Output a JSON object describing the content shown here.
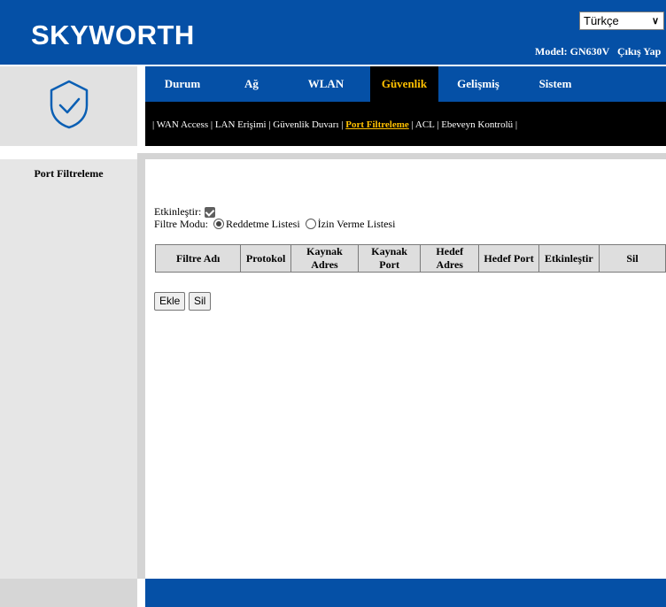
{
  "header": {
    "logo": "SKYWORTH",
    "language": "Türkçe",
    "model": "Model: GN630V",
    "logout": "Çıkış Yap"
  },
  "topnav": {
    "tabs": [
      "Durum",
      "Ağ",
      "WLAN",
      "Güvenlik",
      "Gelişmiş",
      "Sistem"
    ],
    "active": "Güvenlik"
  },
  "subnav": {
    "items": [
      "WAN Access",
      "LAN Erişimi",
      "Güvenlik Duvarı",
      "Port Filtreleme",
      "ACL",
      "Ebeveyn Kontrolü"
    ],
    "active": "Port Filtreleme"
  },
  "sidebar": {
    "item": "Port Filtreleme",
    "icon": "shield-check-icon"
  },
  "form": {
    "enable_label": "Etkinleştir:",
    "enable_checked": true,
    "filter_mode_label": "Filtre Modu:",
    "mode_options": [
      "Reddetme Listesi",
      "İzin Verme Listesi"
    ],
    "mode_selected": "Reddetme Listesi"
  },
  "table": {
    "columns": [
      "Filtre Adı",
      "Protokol",
      "Kaynak Adres",
      "Kaynak Port",
      "Hedef Adres",
      "Hedef Port",
      "Etkinleştir",
      "Sil"
    ]
  },
  "buttons": {
    "add": "Ekle",
    "delete": "Sil"
  },
  "colors": {
    "brand_blue": "#0550a6",
    "active_tab_text": "#ffc000"
  }
}
